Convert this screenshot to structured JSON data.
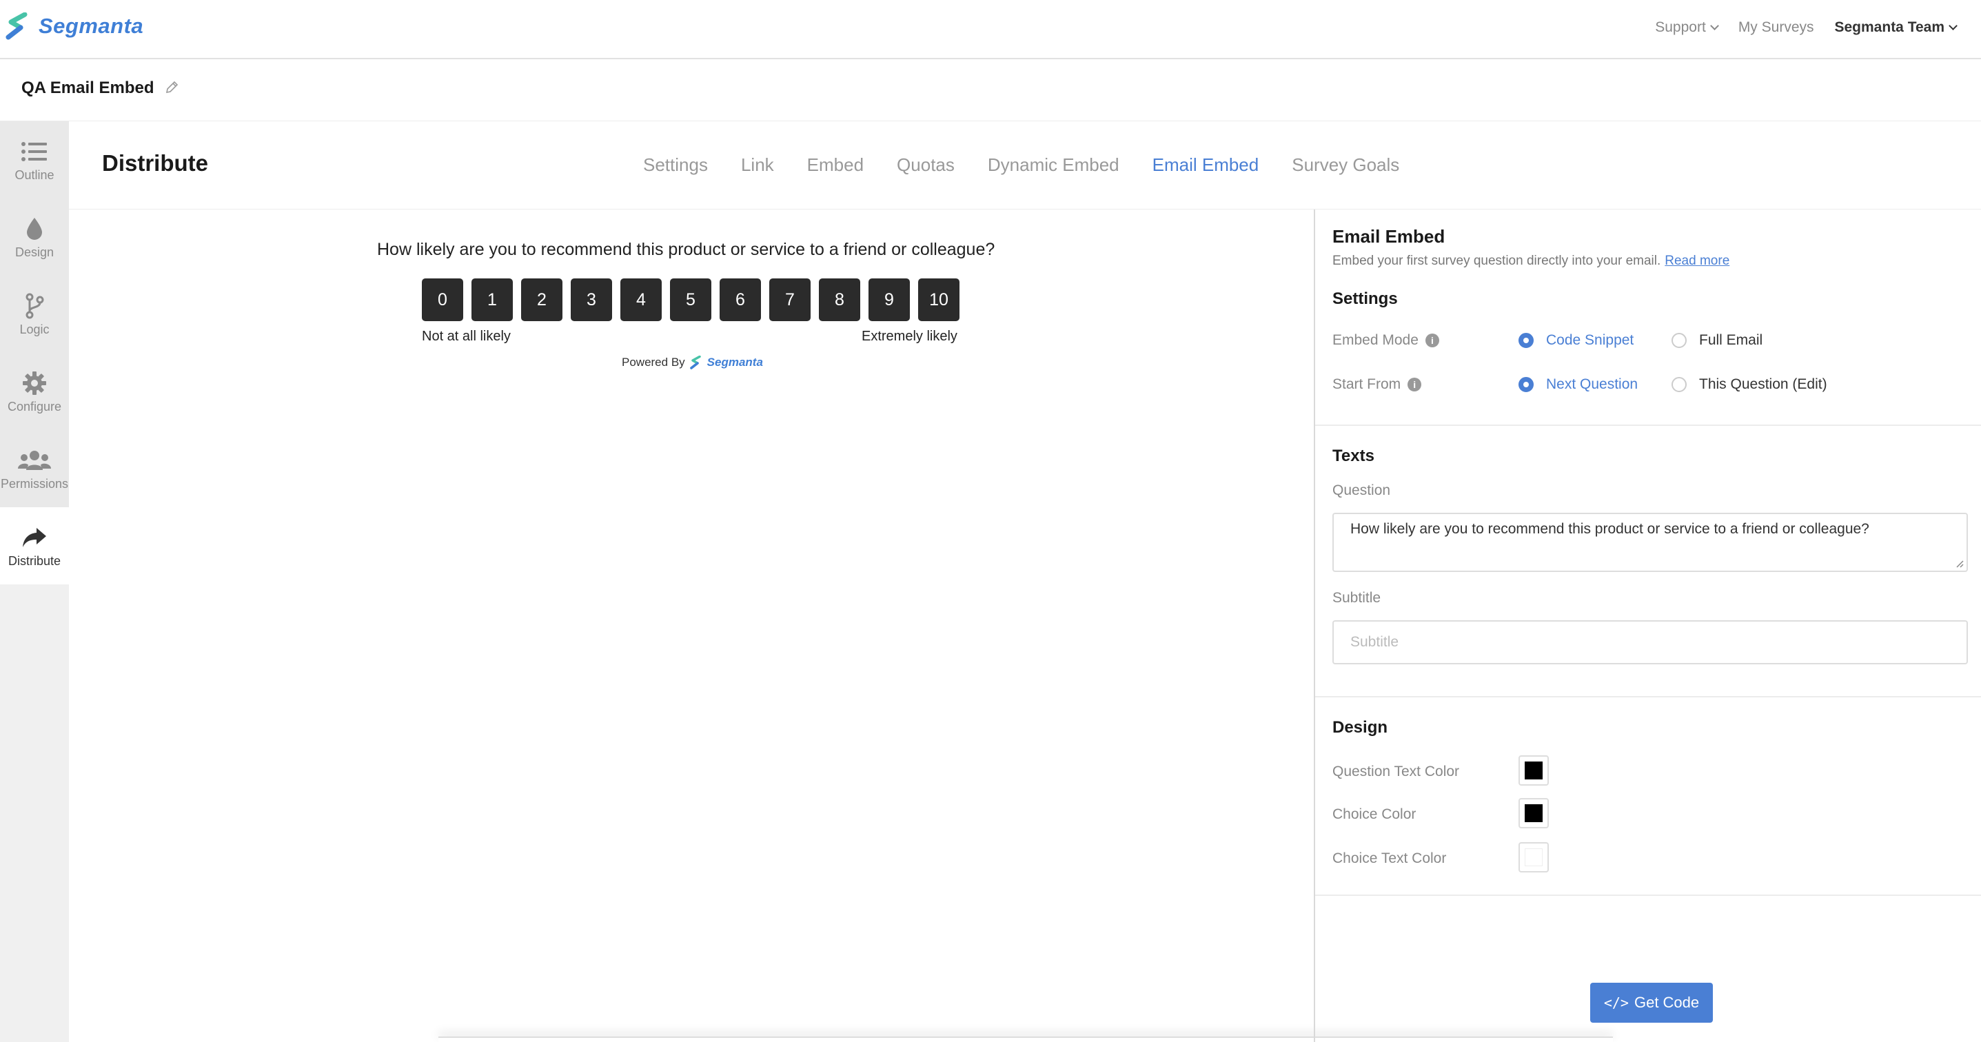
{
  "app": {
    "brand": "Segmanta"
  },
  "topnav": {
    "support": "Support",
    "my_surveys": "My Surveys",
    "team": "Segmanta Team"
  },
  "survey": {
    "title": "QA Email Embed"
  },
  "sidebar": {
    "items": [
      {
        "label": "Outline",
        "icon": "list-icon"
      },
      {
        "label": "Design",
        "icon": "droplet-icon"
      },
      {
        "label": "Logic",
        "icon": "branch-icon"
      },
      {
        "label": "Configure",
        "icon": "gear-icon"
      },
      {
        "label": "Permissions",
        "icon": "users-icon"
      },
      {
        "label": "Distribute",
        "icon": "share-arrow-icon",
        "active": true
      }
    ]
  },
  "distribute": {
    "title": "Distribute",
    "tabs": [
      {
        "label": "Settings"
      },
      {
        "label": "Link"
      },
      {
        "label": "Embed"
      },
      {
        "label": "Quotas"
      },
      {
        "label": "Dynamic Embed"
      },
      {
        "label": "Email Embed",
        "active": true
      },
      {
        "label": "Survey Goals"
      }
    ]
  },
  "preview": {
    "question": "How likely are you to recommend this product or service to a friend or colleague?",
    "scale": [
      "0",
      "1",
      "2",
      "3",
      "4",
      "5",
      "6",
      "7",
      "8",
      "9",
      "10"
    ],
    "low_label": "Not at all likely",
    "high_label": "Extremely likely",
    "powered_by": "Powered By",
    "powered_brand": "Segmanta"
  },
  "panel": {
    "title": "Email Embed",
    "description": "Embed your first survey question directly into your email.",
    "read_more": "Read more",
    "settings": {
      "heading": "Settings",
      "embed_mode": {
        "label": "Embed Mode",
        "options": [
          "Code Snippet",
          "Full Email"
        ],
        "selected": "Code Snippet"
      },
      "start_from": {
        "label": "Start From",
        "options": [
          "Next Question",
          "This Question (Edit)"
        ],
        "selected": "Next Question"
      }
    },
    "texts": {
      "heading": "Texts",
      "question_label": "Question",
      "question_value": "How likely are you to recommend this product or service to a friend or colleague?",
      "subtitle_label": "Subtitle",
      "subtitle_placeholder": "Subtitle"
    },
    "design": {
      "heading": "Design",
      "question_text_color": {
        "label": "Question Text Color",
        "color": "#000000"
      },
      "choice_color": {
        "label": "Choice Color",
        "color": "#000000"
      },
      "choice_text_color": {
        "label": "Choice Text Color",
        "color": "#ffffff"
      }
    },
    "get_code": "Get Code"
  },
  "colors": {
    "accent": "#4a7fd4",
    "scale_button": "#2b2b2b"
  }
}
